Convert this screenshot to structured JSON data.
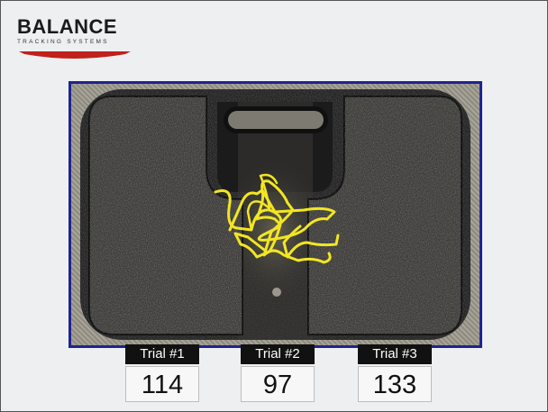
{
  "logo": {
    "title": "BALANCE",
    "subtitle": "TRACKING SYSTEMS"
  },
  "board": {
    "trace_color": "#f2e622",
    "frame_color": "#1f2391"
  },
  "trials": [
    {
      "label": "Trial #1",
      "value": "114"
    },
    {
      "label": "Trial #2",
      "value": "97"
    },
    {
      "label": "Trial #3",
      "value": "133"
    }
  ]
}
